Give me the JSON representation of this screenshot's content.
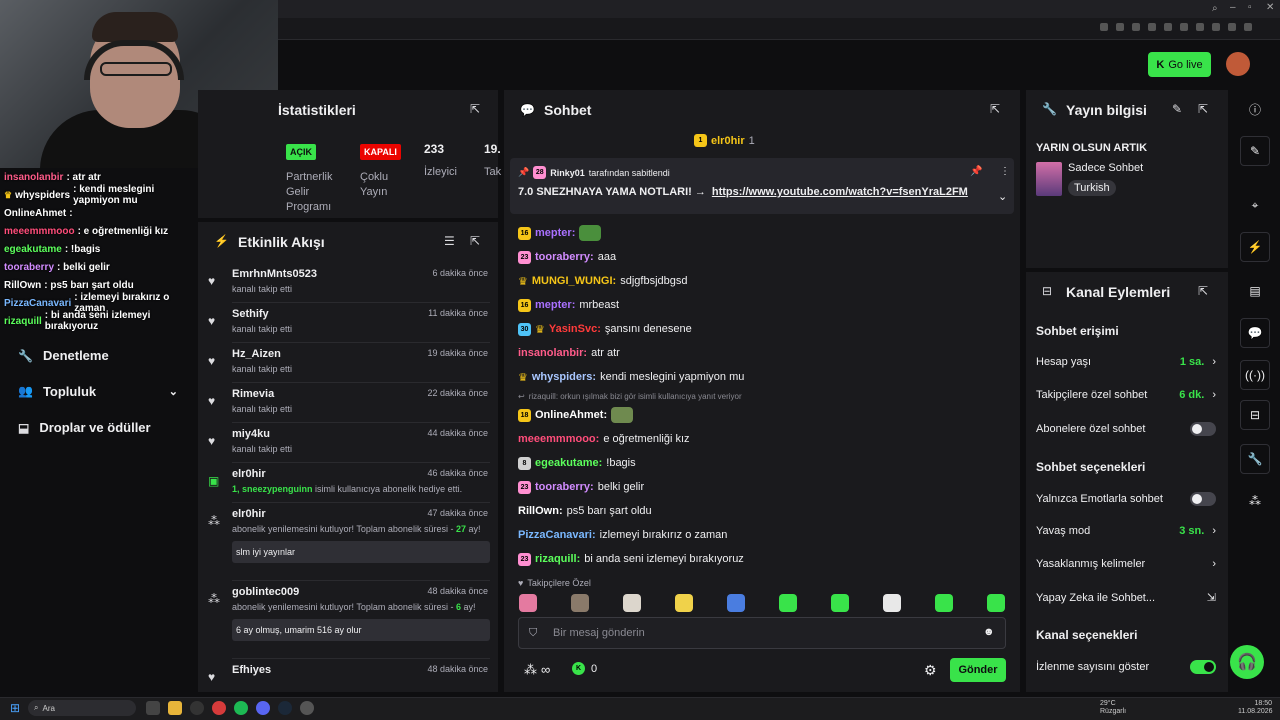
{
  "header": {
    "go_live": "Go live"
  },
  "webcam_overlay_chat": [
    {
      "user": "insanolanbir",
      "color": "#ff5c8a",
      "text": ": atr atr"
    },
    {
      "user": "whyspiders",
      "color": "#ffffff",
      "text": ": kendi meslegini yapmiyon mu",
      "crown": true
    },
    {
      "user": "OnlineAhmet",
      "color": "#ffffff",
      "text": ":"
    },
    {
      "user": "meeemmmooo",
      "color": "#ff4d7a",
      "text": ": e oğretmenliği kız"
    },
    {
      "user": "egeakutame",
      "color": "#5cff5c",
      "text": ": !bagis"
    },
    {
      "user": "tooraberry",
      "color": "#d28cff",
      "text": ": belki gelir"
    },
    {
      "user": "RillOwn",
      "color": "#ffffff",
      "text": ": ps5 barı şart oldu"
    },
    {
      "user": "PizzaCanavari",
      "color": "#7ab8ff",
      "text": ": izlemeyi bırakırız o zaman"
    },
    {
      "user": "rizaquill",
      "color": "#5cff5c",
      "text": ": bi anda seni izlemeyi bırakıyoruz"
    }
  ],
  "sidenav": {
    "items": [
      {
        "label": "Denetleme"
      },
      {
        "label": "Topluluk"
      },
      {
        "label": "Droplar ve ödüller"
      }
    ]
  },
  "stats": {
    "title": "İstatistikleri",
    "cells": [
      {
        "tag": "AÇIK",
        "label": "Partnerlik Gelir Programı"
      },
      {
        "tag": "KAPALI",
        "label": "Çoklu Yayın"
      },
      {
        "value": "233",
        "label": "İzleyici"
      },
      {
        "value": "19.",
        "label": "Tak"
      }
    ]
  },
  "activity": {
    "title": "Etkinlik Akışı",
    "items": [
      {
        "name": "EmrhnMnts0523",
        "sub": "kanalı takip etti",
        "time": "6 dakika önce"
      },
      {
        "name": "Sethify",
        "sub": "kanalı takip etti",
        "time": "11 dakika önce"
      },
      {
        "name": "Hz_Aizen",
        "sub": "kanalı takip etti",
        "time": "19 dakika önce"
      },
      {
        "name": "Rimevia",
        "sub": "kanalı takip etti",
        "time": "22 dakika önce"
      },
      {
        "name": "miy4ku",
        "sub": "kanalı takip etti",
        "time": "44 dakika önce"
      },
      {
        "name": "elr0hir",
        "sub_highlight": "1, sneezypenguinn",
        "sub": "isimli kullanıcıya abonelik hediye etti.",
        "time": "46 dakika önce"
      },
      {
        "name": "elr0hir",
        "sub": "abonelik yenilemesini kutluyor! Toplam abonelik süresi -",
        "sub_highlight": "27",
        "sub_end": "ay!",
        "message": "slm iyi yayınlar",
        "time": "47 dakika önce"
      },
      {
        "name": "goblintec009",
        "sub": "abonelik yenilemesini kutluyor! Toplam abonelik süresi -",
        "sub_highlight": "6",
        "sub_end": "ay!",
        "message": "6 ay olmuş, umarim 516 ay olur",
        "time": "48 dakika önce"
      },
      {
        "name": "Efhiyes",
        "time": "48 dakika önce"
      }
    ]
  },
  "chat": {
    "title": "Sohbet",
    "top_user": {
      "name": "elr0hir",
      "count": "1"
    },
    "pinned": {
      "pinned_by_count": "28",
      "pinned_by": "Rinky01",
      "pinned_suffix": "tarafından sabitlendi",
      "text": "7.0 SNEZHNAYA YAMA NOTLARI! →",
      "link": "https://www.youtube.com/watch?v=fsenYraL2FM"
    },
    "messages": [
      {
        "badge": "16",
        "badge_color": "#f5c518",
        "user": "mepter",
        "color": "#a970ff",
        "text": "",
        "emote": "#4a8f3c"
      },
      {
        "badge": "23",
        "badge_color": "#ff8fd1",
        "user": "tooraberry",
        "color": "#d28cff",
        "text": "aaa"
      },
      {
        "crown": true,
        "user": "MUNGI_WUNGI",
        "color": "#f5c518",
        "text": "sdjgfbsjdbgsd"
      },
      {
        "badge": "16",
        "badge_color": "#f5c518",
        "user": "mepter",
        "color": "#a970ff",
        "text": "mrbeast"
      },
      {
        "badge": "30",
        "badge_color": "#4fc3f7",
        "crown": true,
        "user": "YasinSvc",
        "color": "#ff3b3b",
        "text": "şansını denesene"
      },
      {
        "user": "insanolanbir",
        "color": "#ff5c8a",
        "text": "atr atr"
      },
      {
        "crown": true,
        "user": "whyspiders",
        "color": "#a9c7ff",
        "text": "kendi meslegini yapmiyon mu"
      },
      {
        "badge": "18",
        "badge_color": "#f5c518",
        "user": "OnlineAhmet",
        "color": "#ffffff",
        "text": "",
        "emote": "#6f8a4f",
        "reply": "rizaquill: orkun ışılmak bizi gör isimli kullanıcıya yanıt veriyor"
      },
      {
        "user": "meeemmmooo",
        "color": "#ff4d7a",
        "text": "e oğretmenliği kız"
      },
      {
        "badge": "8",
        "badge_color": "#d0d0d0",
        "user": "egeakutame",
        "color": "#5cff5c",
        "text": "!bagis"
      },
      {
        "badge": "23",
        "badge_color": "#ff8fd1",
        "user": "tooraberry",
        "color": "#d28cff",
        "text": "belki gelir"
      },
      {
        "user": "RillOwn",
        "color": "#ffffff",
        "text": "ps5 barı şart oldu"
      },
      {
        "user": "PizzaCanavari",
        "color": "#7ab8ff",
        "text": "izlemeyi bırakırız o zaman"
      },
      {
        "badge": "23",
        "badge_color": "#ff8fd1",
        "user": "rizaquill",
        "color": "#5cff5c",
        "text": "bi anda seni izlemeyi bırakıyoruz"
      }
    ],
    "emote_section_label": "Takipçilere Özel",
    "emote_colors": [
      "#e47aa0",
      "#8a7a6a",
      "#dcd6cc",
      "#f0d24a",
      "#4a7de0",
      "#39e34a",
      "#39e34a",
      "#e8e8e8",
      "#39e34a",
      "#39e34a"
    ],
    "input_placeholder": "Bir mesaj gönderin",
    "points": "0",
    "send": "Gönder"
  },
  "stream_info": {
    "title": "Yayın bilgisi",
    "stream_title": "YARIN OLSUN ARTIK",
    "category": "Sadece Sohbet",
    "language": "Turkish"
  },
  "channel_actions": {
    "title": "Kanal Eylemleri",
    "chat_access_title": "Sohbet erişimi",
    "chat_access": [
      {
        "label": "Hesap yaşı",
        "value": "1 sa."
      },
      {
        "label": "Takipçilere özel sohbet",
        "value": "6 dk."
      },
      {
        "label": "Abonelere özel sohbet",
        "toggle": "off"
      }
    ],
    "chat_options_title": "Sohbet seçenekleri",
    "chat_options": [
      {
        "label": "Yalnızca Emotlarla sohbet",
        "toggle": "off"
      },
      {
        "label": "Yavaş mod",
        "value": "3 sn."
      },
      {
        "label": "Yasaklanmış kelimeler"
      },
      {
        "label": "Yapay Zeka ile Sohbet..."
      }
    ],
    "channel_options_title": "Kanal seçenekleri",
    "channel_options": [
      {
        "label": "İzlenme sayısını göster",
        "toggle": "on"
      }
    ]
  },
  "taskbar": {
    "search": "Ara",
    "weather_temp": "29°C",
    "weather_desc": "Rüzgarlı",
    "time": "18:50",
    "date": "11.08.2026"
  },
  "colors": {
    "accent": "#39e34a",
    "bg": "#0e0e10",
    "panel": "#1a1a1d"
  }
}
